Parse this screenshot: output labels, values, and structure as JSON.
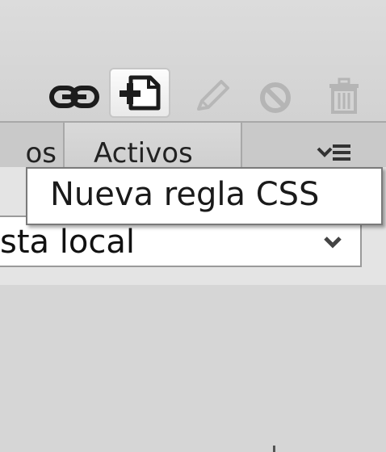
{
  "toolbar": {
    "buttons": [
      {
        "name": "attach-style-sheet",
        "icon": "chain-link-icon"
      },
      {
        "name": "new-css-rule",
        "icon": "new-document-plus-icon"
      },
      {
        "name": "edit-rule",
        "icon": "pencil-icon"
      },
      {
        "name": "disable-rule",
        "icon": "prohibited-icon"
      },
      {
        "name": "delete-rule",
        "icon": "trash-icon"
      }
    ]
  },
  "tabs": {
    "previous_partial_label": "os",
    "active_label": "Activos",
    "menu_icon": "panel-menu-icon"
  },
  "tooltip": {
    "text": "Nueva regla CSS"
  },
  "site_select": {
    "value": "sta local",
    "chevron_icon": "chevron-down-icon"
  },
  "colors": {
    "toolbar_bg": "#d6d6d6",
    "tab_bar_bg": "#c9c9c9",
    "panel_bg": "#e4e4e4",
    "tooltip_bg": "#ffffff"
  }
}
